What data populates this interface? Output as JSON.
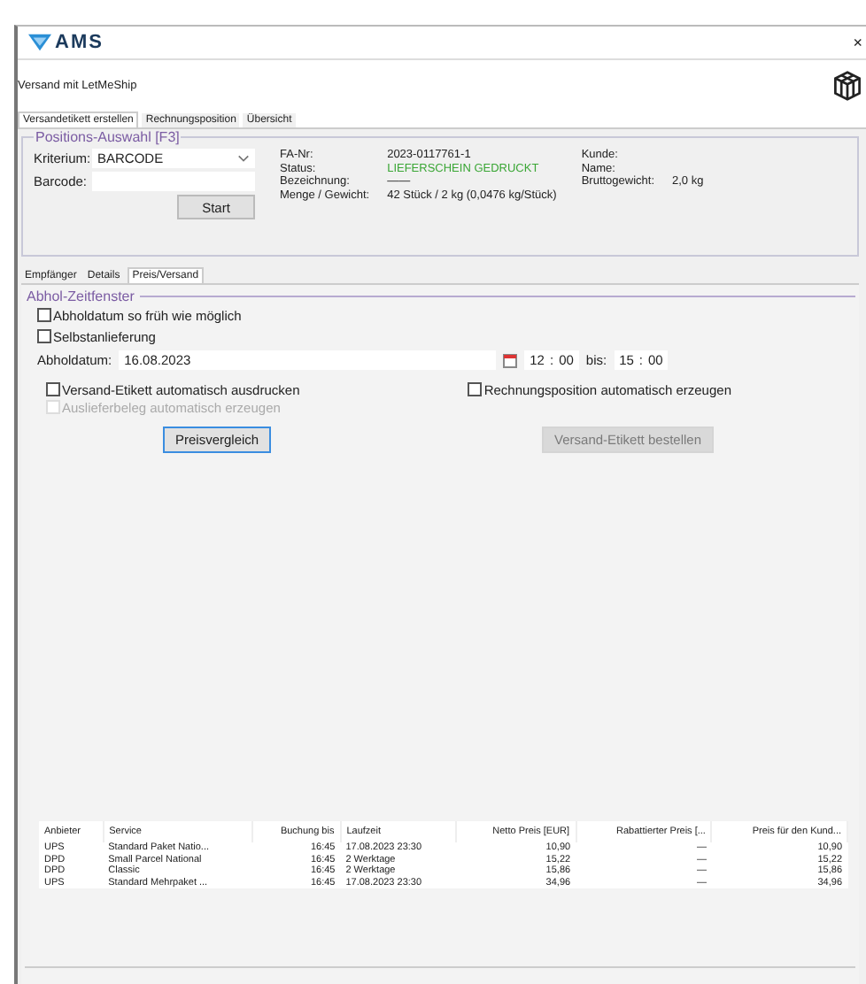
{
  "app": {
    "logo": "AMS",
    "close": "×"
  },
  "subtitle": "Versand mit LetMeShip",
  "tabs": [
    {
      "label": "Versandetikett erstellen",
      "selected": true
    },
    {
      "label": "Rechnungsposition",
      "selected": false
    },
    {
      "label": "Übersicht",
      "selected": false
    }
  ],
  "selection": {
    "title": "Positions-Auswahl [F3]",
    "criterion_label": "Kriterium:",
    "criterion_value": "BARCODE",
    "barcode_label": "Barcode:",
    "button": "Start"
  },
  "info": [
    {
      "label": "FA-Nr:",
      "value": "2023-0117761-1"
    },
    {
      "label": "Status:",
      "value": "LIEFERSCHEIN GEDRUCKT",
      "color": "#3aa635"
    },
    {
      "label": "Bezeichnung:",
      "value": "——"
    },
    {
      "label": "Menge / Gewicht:",
      "value": "42 Stück / 2 kg (0,0476 kg/Stück)"
    }
  ],
  "customer": [
    {
      "label": "Kunde:"
    },
    {
      "label": "Name:"
    },
    {
      "label": "Bruttogewicht:",
      "value": "2,0 kg"
    }
  ],
  "subtabs": [
    {
      "label": "Empfänger",
      "selected": false
    },
    {
      "label": "Details",
      "selected": false
    },
    {
      "label": "Preis/Versand",
      "selected": true
    }
  ],
  "pickup": {
    "title": "Abhol-Zeitfenster",
    "options": [
      {
        "label": "Abholdatum so früh wie möglich",
        "checked": false
      },
      {
        "label": "Selbstanlieferung",
        "checked": false
      }
    ],
    "date_label": "Abholdatum:",
    "date": "16.08.2023",
    "from_h": "12",
    "from_sep": ":",
    "from_m": "00",
    "until_label": "bis:",
    "until_h": "15",
    "until_sep": ":",
    "until_m": "00"
  },
  "auto": [
    {
      "label": "Versand-Etikett automatisch ausdrucken",
      "checked": false,
      "disabled": false
    },
    {
      "label": "Auslieferbeleg automatisch erzeugen",
      "checked": false,
      "disabled": true
    }
  ],
  "auto_right": {
    "label": "Rechnungsposition automatisch erzeugen",
    "checked": false,
    "disabled": false
  },
  "buttons": [
    {
      "label": "Preisvergleich",
      "disabled": false
    },
    {
      "label": "Versand-Etikett bestellen",
      "disabled": true
    }
  ],
  "table": {
    "columns": [
      "Anbieter",
      "Service",
      "Buchung bis",
      "Laufzeit",
      "Netto Preis [EUR]",
      "Rabattierter Preis [...",
      "Preis für den Kund..."
    ],
    "rows": [
      [
        "UPS",
        "Standard Paket Natio...",
        "16:45",
        "17.08.2023 23:30",
        "10,90",
        "—",
        "10,90"
      ],
      [
        "DPD",
        "Small Parcel National",
        "16:45",
        "2 Werktage",
        "15,22",
        "—",
        "15,22"
      ],
      [
        "DPD",
        "Classic",
        "16:45",
        "2 Werktage",
        "15,86",
        "—",
        "15,86"
      ],
      [
        "UPS",
        "Standard Mehrpaket ...",
        "16:45",
        "17.08.2023 23:30",
        "34,96",
        "—",
        "34,96"
      ]
    ]
  }
}
